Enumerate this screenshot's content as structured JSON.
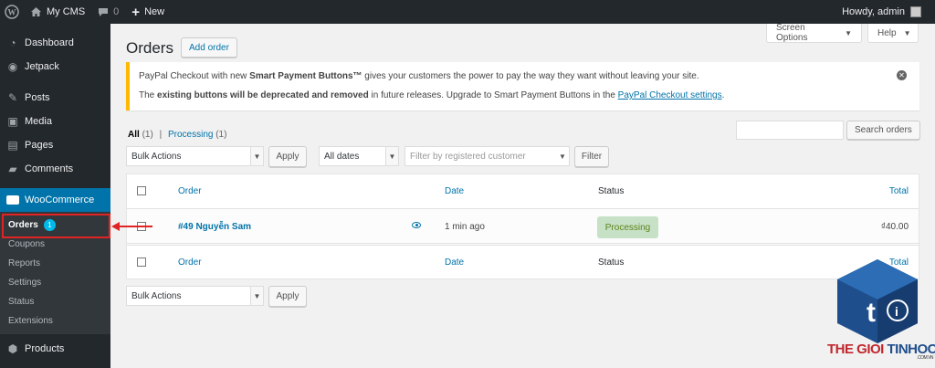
{
  "adminbar": {
    "site_name": "My CMS",
    "comments_count": "0",
    "new_label": "New",
    "greeting": "Howdy, admin"
  },
  "sidebar": {
    "items": [
      {
        "label": "Dashboard",
        "icon": "dashboard-icon"
      },
      {
        "label": "Jetpack",
        "icon": "jetpack-icon"
      },
      {
        "label": "Posts",
        "icon": "pin-icon"
      },
      {
        "label": "Media",
        "icon": "media-icon"
      },
      {
        "label": "Pages",
        "icon": "pages-icon"
      },
      {
        "label": "Comments",
        "icon": "comment-icon"
      },
      {
        "label": "WooCommerce",
        "icon": "woocommerce-icon"
      }
    ],
    "woo_submenu": [
      {
        "label": "Orders",
        "badge": "1"
      },
      {
        "label": "Coupons"
      },
      {
        "label": "Reports"
      },
      {
        "label": "Settings"
      },
      {
        "label": "Status"
      },
      {
        "label": "Extensions"
      }
    ],
    "products_label": "Products"
  },
  "header": {
    "title": "Orders",
    "add_order_label": "Add order",
    "screen_options_label": "Screen Options",
    "help_label": "Help"
  },
  "notice": {
    "line1_pre": "PayPal Checkout with new ",
    "line1_bold": "Smart Payment Buttons™",
    "line1_post": " gives your customers the power to pay the way they want without leaving your site.",
    "line2_pre": "The ",
    "line2_bold": "existing buttons will be deprecated and removed",
    "line2_mid": " in future releases. Upgrade to Smart Payment Buttons in the ",
    "line2_link": "PayPal Checkout settings",
    "line2_end": "."
  },
  "filters": {
    "all_label": "All",
    "all_count": "(1)",
    "separator": "|",
    "processing_label": "Processing",
    "processing_count": "(1)",
    "bulk_actions": "Bulk Actions",
    "apply_label": "Apply",
    "dates": "All dates",
    "customer_placeholder": "Filter by registered customer",
    "filter_label": "Filter",
    "search_button": "Search orders"
  },
  "table": {
    "columns": {
      "order": "Order",
      "date": "Date",
      "status": "Status",
      "total": "Total"
    },
    "rows": [
      {
        "order": "#49 Nguyễn Sam",
        "date": "1 min ago",
        "status": "Processing",
        "total": "₫40.00"
      }
    ]
  },
  "watermark": {
    "part1": "THE GIOI ",
    "part2": "TINHOC",
    "domain": ".COM.VN"
  },
  "colors": {
    "accent": "#0073aa",
    "sidebar_bg": "#23282d",
    "notice_border": "#ffb900",
    "status_processing_bg": "#c6e1c6",
    "annotation": "#e02424"
  }
}
